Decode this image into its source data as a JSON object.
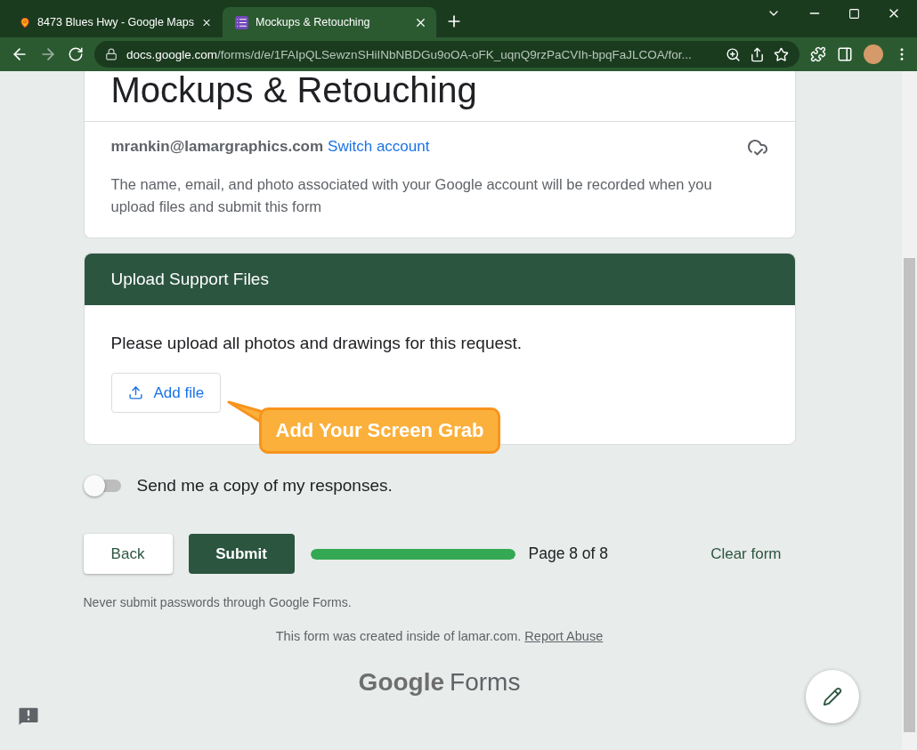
{
  "browser": {
    "tabs": [
      {
        "title": "8473 Blues Hwy - Google Maps",
        "kind": "maps",
        "selected": false
      },
      {
        "title": "Mockups & Retouching",
        "kind": "forms",
        "selected": true
      }
    ],
    "url": {
      "host": "docs.google.com",
      "path": "/forms/d/e/1FAIpQLSewznSHiINbNBDGu9oOA-oFK_uqnQ9rzPaCVIh-bpqFaJLCOA/for..."
    }
  },
  "form": {
    "title": "Mockups & Retouching",
    "account": "mrankin@lamargraphics.com",
    "switch_account": "Switch account",
    "notice": "The name, email, and photo associated with your Google account will be recorded when you upload files and submit this form"
  },
  "section": {
    "title": "Upload Support Files",
    "description": "Please upload all photos and drawings for this request.",
    "add_file": "Add file",
    "callout": "Add Your Screen Grab"
  },
  "copy_toggle": {
    "label": "Send me a copy of my responses.",
    "on": false
  },
  "nav": {
    "back": "Back",
    "submit": "Submit",
    "progress": {
      "level": 1,
      "label": "Page 8 of 8"
    },
    "clear": "Clear form"
  },
  "password_note": "Never submit passwords through Google Forms.",
  "footer": {
    "text": "This form was created inside of lamar.com.",
    "link": "Report Abuse"
  },
  "logo": {
    "brand": "Google",
    "product": "Forms"
  }
}
